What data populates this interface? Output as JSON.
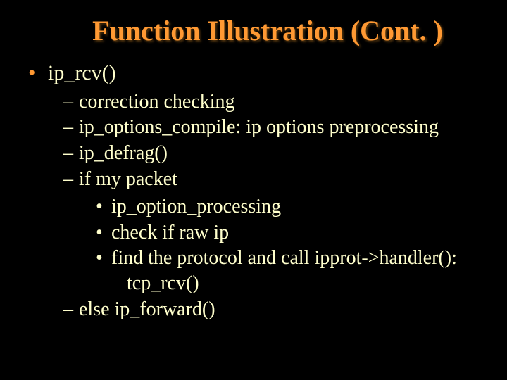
{
  "title": "Function Illustration (Cont. )",
  "bullets": {
    "l1_0": "ip_rcv()",
    "l2_0": "correction checking",
    "l2_1": "ip_options_compile: ip options preprocessing",
    "l2_2": "ip_defrag()",
    "l2_3": "if my packet",
    "l3_0": "ip_option_processing",
    "l3_1": "check if raw ip",
    "l3_2": "find the protocol and call ipprot->handler():",
    "l3_2b": "tcp_rcv()",
    "l2_4": "else ip_forward()"
  }
}
